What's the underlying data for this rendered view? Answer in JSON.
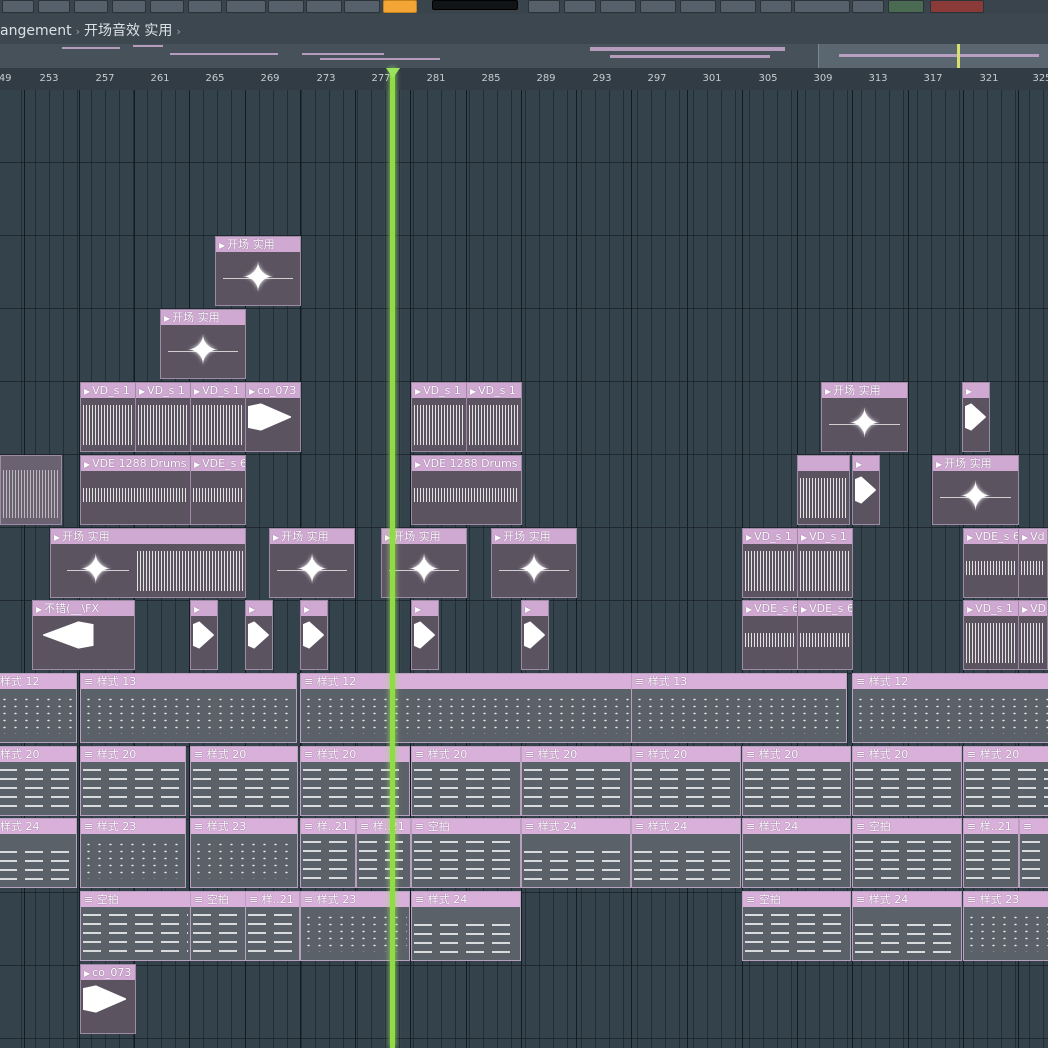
{
  "breadcrumb": {
    "section": "angement",
    "pattern": "开场音效 实用"
  },
  "ruler": {
    "bars": [
      "249",
      "253",
      "257",
      "261",
      "265",
      "269",
      "273",
      "277",
      "281",
      "285",
      "289",
      "293",
      "297",
      "301",
      "305",
      "309",
      "313",
      "317",
      "321",
      "325"
    ]
  },
  "toolbar": {
    "buttons": [
      "",
      "",
      "",
      "",
      "",
      "",
      "",
      "",
      "",
      "",
      "",
      "",
      "",
      "",
      ""
    ]
  },
  "playhead": {
    "bar": 278
  },
  "clips": {
    "k1": "开场 实用",
    "k2": "开场 实用",
    "v1": "VD_s 1",
    "v2": "VD_s 1",
    "v3": "VD_s 1",
    "co1": "co_073",
    "v4": "VD_s 1",
    "v5": "VD_s 1",
    "k3": "开场 实用",
    "d1": "VDE 1288 Drums 6",
    "d2": "VDE_s 6",
    "d3": "VDE 1288 Drums 6",
    "k4": "开场 实用",
    "k5": "开场 实用",
    "k6": "开场 实用",
    "k7": "开场 实用",
    "k8": "开场 实用",
    "v6": "VD_s 1",
    "v7": "VD_s 1",
    "k9": "开场 实用",
    "d4": "VDE_s 6",
    "d5": "Vd",
    "fx": "不错(__\\FX",
    "d6": "VDE_s 6",
    "d7": "VDE_s 6",
    "v8": "VD_s 1",
    "v9": "VD_s 1",
    "p12a": "样式 12",
    "p13a": "样式 13",
    "p12b": "样式 12",
    "p13b": "样式 13",
    "p12c": "样式 12",
    "p20a": "样式 20",
    "p20b": "样式 20",
    "p20c": "样式 20",
    "p20d": "样式 20",
    "p20e": "样式 20",
    "p20f": "样式 20",
    "p20g": "样式 20",
    "p20h": "样式 20",
    "p20i": "样式 20",
    "p20j": "样式 20",
    "p24a": "样式 24",
    "p23a": "样式 23",
    "p23b": "样式 23",
    "p21a": "样..21",
    "p21b": "样..21",
    "kp1": "空拍",
    "p24b": "样式 24",
    "p24c": "样式 24",
    "p24d": "样式 24",
    "kp2": "空拍",
    "p21c": "样..21",
    "kp3": "空拍",
    "kp4": "空拍",
    "p21d": "样..21",
    "p23c": "样式 23",
    "p24e": "样式 24",
    "kp5": "空拍",
    "p24f": "样式 24",
    "p23d": "样式 23",
    "co2": "co_073"
  }
}
